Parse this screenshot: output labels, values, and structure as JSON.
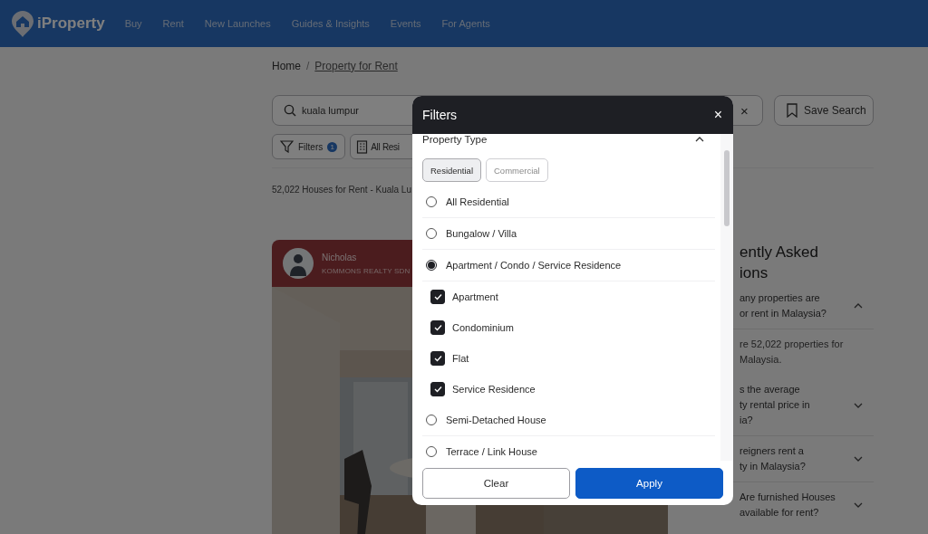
{
  "header": {
    "brand": "iProperty",
    "nav": [
      {
        "label": "Buy"
      },
      {
        "label": "Rent"
      },
      {
        "label": "New Launches"
      },
      {
        "label": "Guides & Insights"
      },
      {
        "label": "Events"
      },
      {
        "label": "For Agents"
      }
    ]
  },
  "breadcrumb": {
    "items": [
      "Home",
      "Property for Rent"
    ],
    "separator": "/"
  },
  "search": {
    "value": "kuala lumpur",
    "clear": "×",
    "save": "Save Search"
  },
  "chips": [
    {
      "kind": "filters",
      "label": "Filters",
      "badge": "1"
    },
    {
      "kind": "type",
      "label": "All Resi"
    }
  ],
  "results": "52,022 Houses for Rent - Kuala Lu",
  "listing": {
    "agent": "Nicholas",
    "agency": "KOMMONS REALTY SDN",
    "kind": "picture"
  },
  "faq": {
    "title_lines": [
      "ently Asked",
      "ions"
    ],
    "items": [
      {
        "question_lines": [
          "any properties are",
          "or rent in Malaysia?"
        ],
        "expanded": true,
        "answer_lines": [
          "re 52,022 properties for",
          "Malaysia."
        ]
      },
      {
        "question_lines": [
          "s the average",
          "ty rental price in",
          "ia?"
        ],
        "expanded": false
      },
      {
        "question_lines": [
          "reigners rent a",
          "ty in Malaysia?"
        ],
        "expanded": false
      },
      {
        "question_lines": [
          "Are furnished Houses",
          "available for rent?"
        ],
        "expanded": false
      }
    ]
  },
  "filters": {
    "title": "Filters",
    "close": "×",
    "section": "Property Type",
    "section_expanded": true,
    "type_tabs": [
      {
        "label": "Residential",
        "selected": true
      },
      {
        "label": "Commercial",
        "selected": false
      }
    ],
    "options": [
      {
        "kind": "radio",
        "label": "All Residential",
        "selected": false
      },
      {
        "kind": "radio",
        "label": "Bungalow / Villa",
        "selected": false
      },
      {
        "kind": "radio",
        "label": "Apartment / Condo / Service Residence",
        "selected": true
      },
      {
        "kind": "checkbox",
        "label": "Apartment",
        "checked": true
      },
      {
        "kind": "checkbox",
        "label": "Condominium",
        "checked": true
      },
      {
        "kind": "checkbox",
        "label": "Flat",
        "checked": true
      },
      {
        "kind": "checkbox",
        "label": "Service Residence",
        "checked": true
      },
      {
        "kind": "radio",
        "label": "Semi-Detached House",
        "selected": false
      },
      {
        "kind": "radio",
        "label": "Terrace / Link House",
        "selected": false
      }
    ],
    "clear": "Clear",
    "apply": "Apply"
  }
}
